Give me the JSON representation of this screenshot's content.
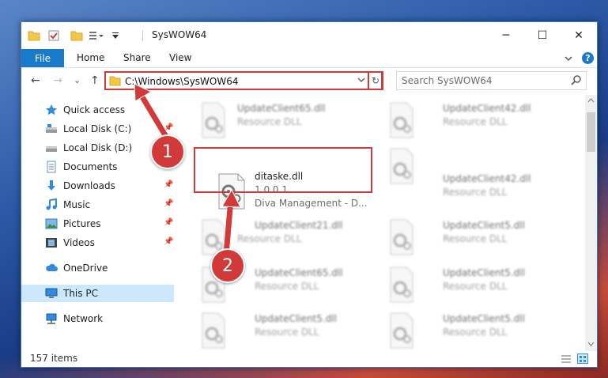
{
  "window": {
    "title": "SysWOW64",
    "controls": {
      "minimize": "─",
      "maximize": "☐",
      "close": "✕"
    }
  },
  "ribbon": {
    "file_tab": "File",
    "tabs": [
      "Home",
      "Share",
      "View"
    ],
    "expand_icon": "chevron-down-icon",
    "help_label": "?"
  },
  "navigation": {
    "back": "←",
    "forward": "→",
    "recent": "⌄",
    "up": "↑",
    "address_path": "C:\\Windows\\SysWOW64",
    "refresh": "↻",
    "search_placeholder": "Search SysWOW64"
  },
  "sidebar": {
    "items": [
      {
        "label": "Quick access",
        "icon": "star-icon",
        "pinned": false
      },
      {
        "label": "Local Disk (C:)",
        "icon": "drive-icon",
        "pinned": true
      },
      {
        "label": "Local Disk (D:)",
        "icon": "drive-icon",
        "pinned": false
      },
      {
        "label": "Documents",
        "icon": "documents-icon",
        "pinned": true
      },
      {
        "label": "Downloads",
        "icon": "downloads-icon",
        "pinned": true
      },
      {
        "label": "Music",
        "icon": "music-icon",
        "pinned": true
      },
      {
        "label": "Pictures",
        "icon": "pictures-icon",
        "pinned": true
      },
      {
        "label": "Videos",
        "icon": "videos-icon",
        "pinned": true
      },
      {
        "label": "OneDrive",
        "icon": "cloud-icon",
        "pinned": false
      },
      {
        "label": "This PC",
        "icon": "computer-icon",
        "pinned": false,
        "selected": true
      },
      {
        "label": "Network",
        "icon": "network-icon",
        "pinned": false
      }
    ]
  },
  "files": {
    "left_column": [
      {
        "name": "UpdateClient65.dll",
        "type": "Resource DLL"
      },
      {
        "name": "ditaske.dll",
        "version": "1.0.0.1",
        "description": "Diva Management - D...",
        "highlighted": true
      },
      {
        "name": "UpdateClient21.dll",
        "type": "Resource DLL"
      },
      {
        "name": "UpdateClient65.dll",
        "type": "Resource DLL"
      },
      {
        "name": "UpdateClient5.dll",
        "type": "Resource DLL"
      }
    ],
    "right_column": [
      {
        "name": "UpdateClient42.dll",
        "type": "Resource DLL"
      },
      {
        "name": "UpdateClient42.dll",
        "type": "Resource DLL"
      },
      {
        "name": "UpdateClient5.dll",
        "type": "Resource DLL"
      },
      {
        "name": "UpdateClient5.dll",
        "type": "Resource DLL"
      },
      {
        "name": "UpdateClient5.dll",
        "type": "Resource DLL"
      }
    ]
  },
  "status": {
    "item_count": "157 items"
  },
  "annotations": {
    "step1": "1",
    "step2": "2"
  },
  "colors": {
    "accent": "#1979ca",
    "highlight": "#d23a3a",
    "selected_bg": "#cce8ff"
  }
}
